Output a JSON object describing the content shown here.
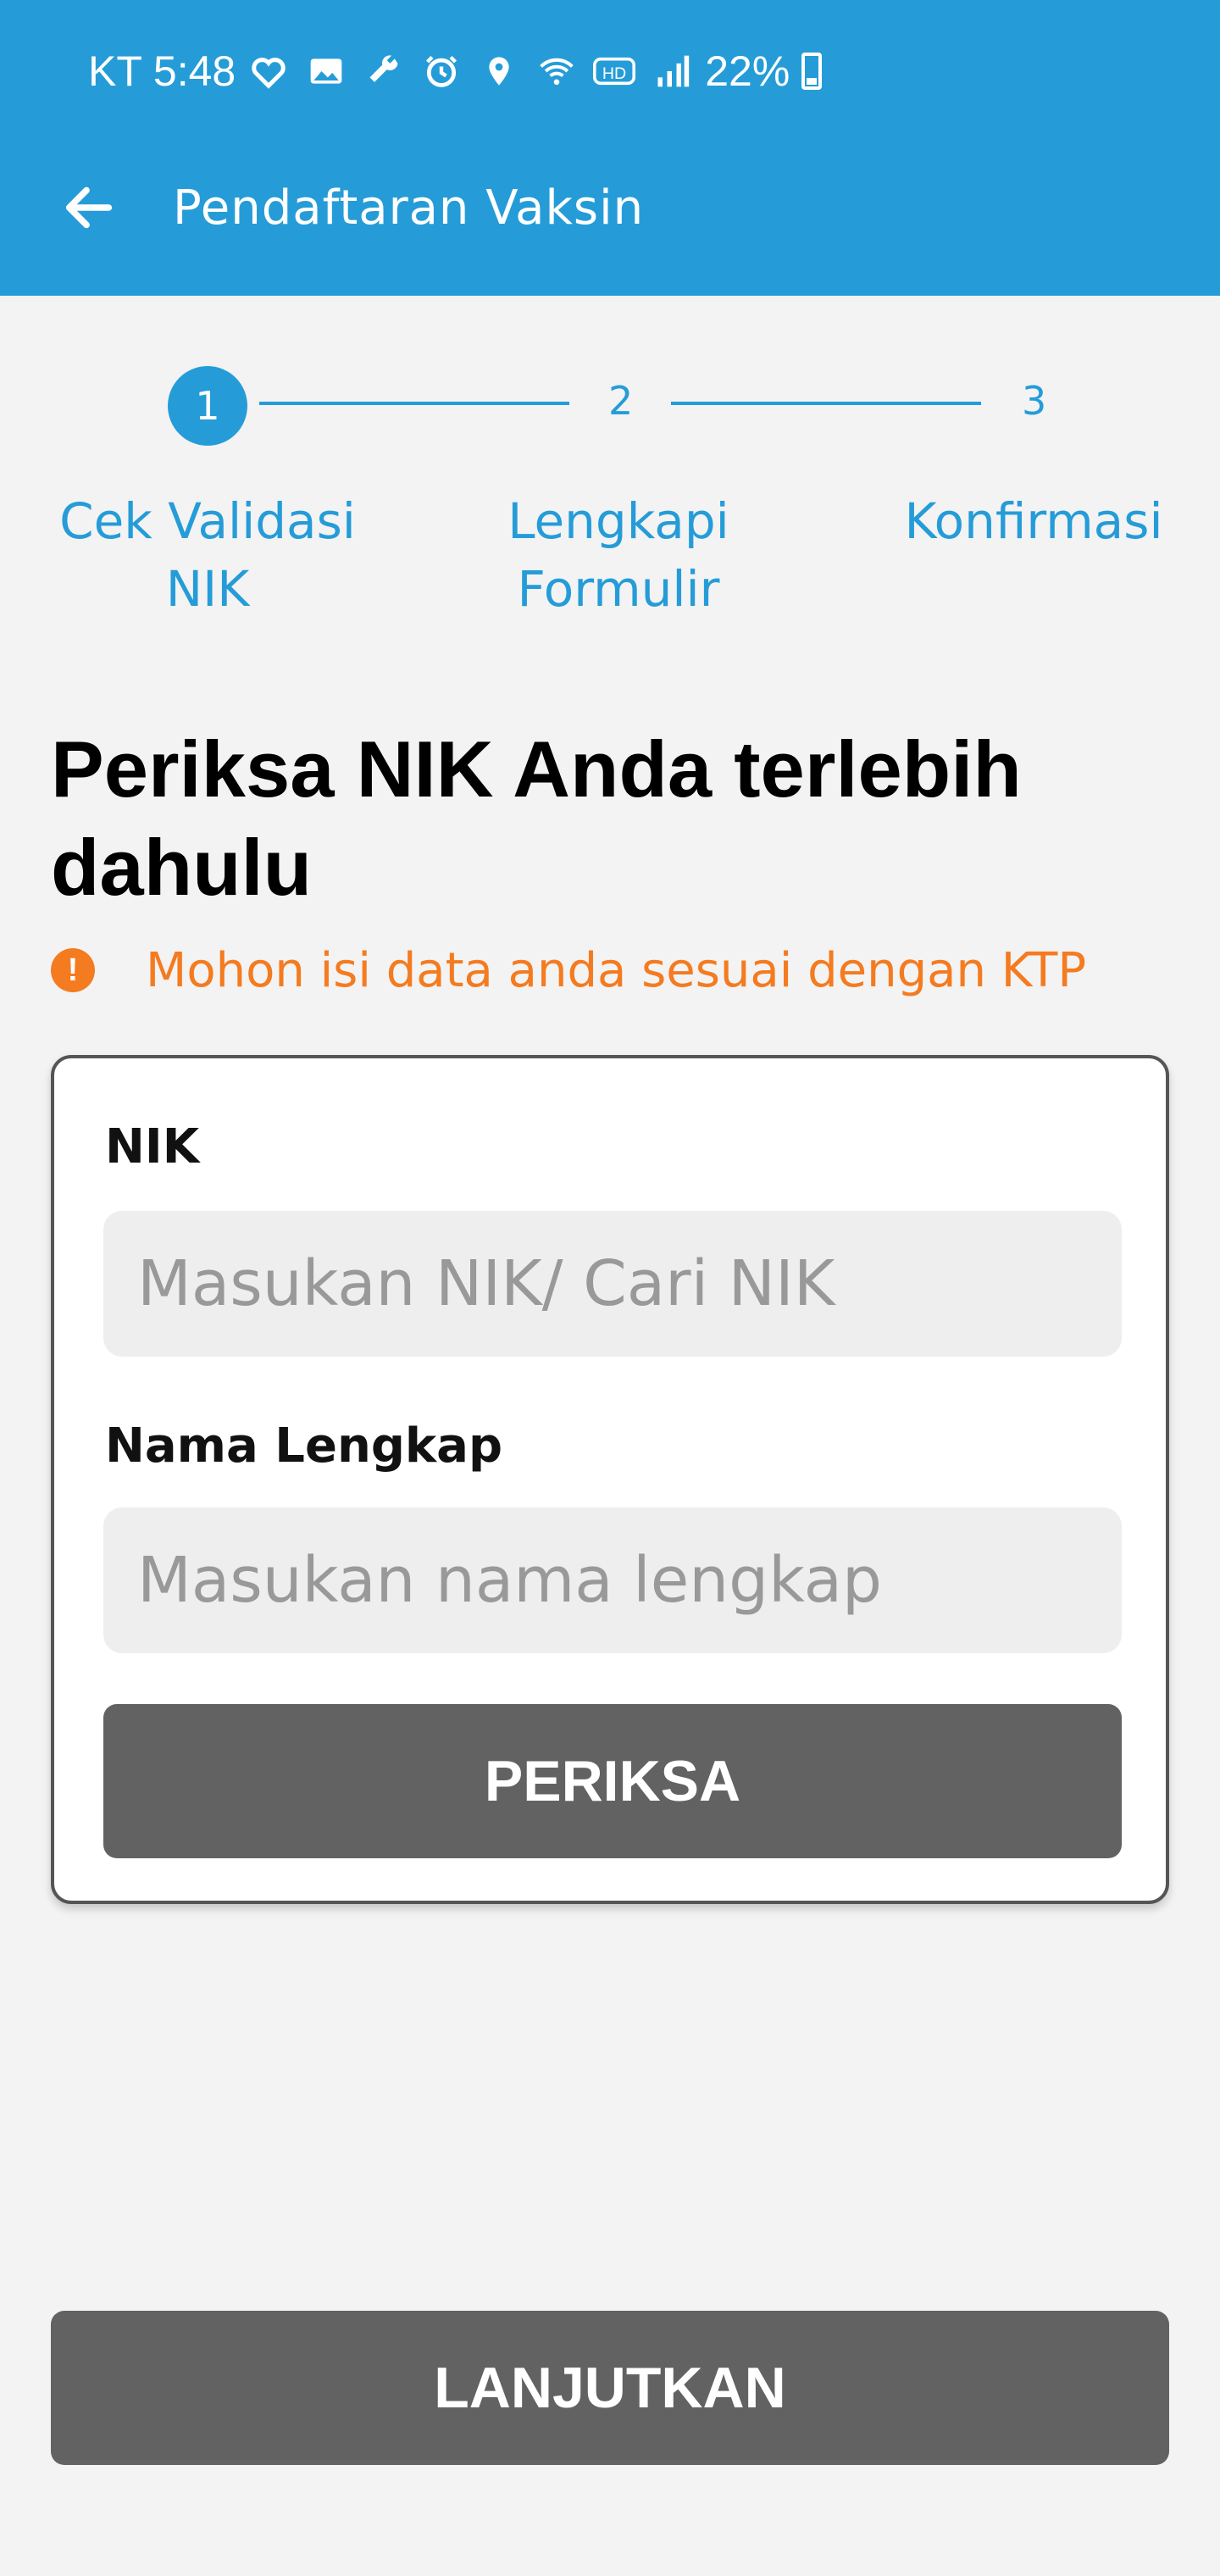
{
  "status_bar": {
    "carrier_time": "KT 5:48",
    "battery": "22%",
    "icons": [
      "heart-icon",
      "image-icon",
      "wrench-icon",
      "alarm-icon",
      "location-icon",
      "wifi-icon",
      "hd-icon",
      "signal-icon",
      "battery-icon"
    ]
  },
  "toolbar": {
    "title": "Pendaftaran Vaksin",
    "back_icon": "arrow-left-icon"
  },
  "stepper": {
    "steps": [
      {
        "number": "1",
        "label": "Cek Validasi NIK",
        "active": true
      },
      {
        "number": "2",
        "label": "Lengkapi Formulir",
        "active": false
      },
      {
        "number": "3",
        "label": "Konfirmasi",
        "active": false
      }
    ]
  },
  "page": {
    "heading": "Periksa NIK Anda terlebih dahulu",
    "notice": "Mohon isi data anda sesuai dengan KTP",
    "notice_icon": "info-icon"
  },
  "form": {
    "nik_label": "NIK",
    "nik_placeholder": "Masukan NIK/ Cari NIK",
    "name_label": "Nama Lengkap",
    "name_placeholder": "Masukan nama lengkap",
    "check_button": "PERIKSA"
  },
  "footer": {
    "continue_button": "LANJUTKAN"
  },
  "colors": {
    "primary": "#259cd8",
    "warning": "#f47b20",
    "button": "#626262",
    "background": "#f3f3f3"
  }
}
